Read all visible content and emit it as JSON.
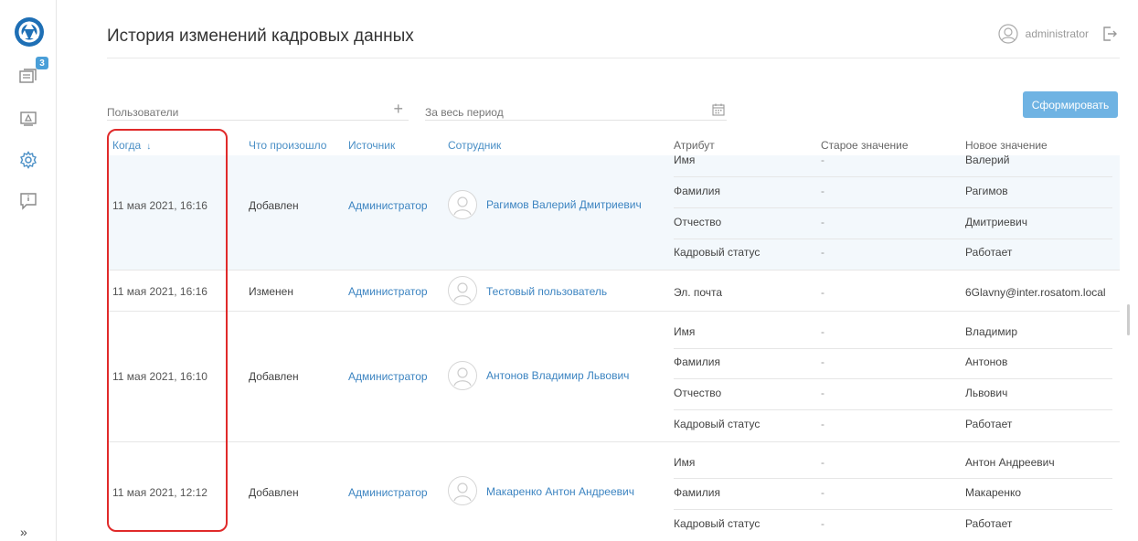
{
  "sidebar": {
    "badge_count": "3",
    "expand_label": "»"
  },
  "header": {
    "title": "История изменений кадровых данных",
    "username": "administrator"
  },
  "filters": {
    "users_placeholder": "Пользователи",
    "period_value": "За весь период",
    "generate_label": "Сформировать"
  },
  "table": {
    "columns": {
      "when": "Когда",
      "what": "Что произошло",
      "source": "Источник",
      "employee": "Сотрудник",
      "attribute": "Атрибут",
      "old_value": "Старое значение",
      "new_value": "Новое значение"
    },
    "rows": [
      {
        "when": "11 мая 2021, 16:16",
        "what": "Добавлен",
        "source": "Администратор",
        "employee": "Рагимов Валерий Дмитриевич",
        "changes": [
          {
            "attribute": "Имя",
            "old": "-",
            "new": "Валерий"
          },
          {
            "attribute": "Фамилия",
            "old": "-",
            "new": "Рагимов"
          },
          {
            "attribute": "Отчество",
            "old": "-",
            "new": "Дмитриевич"
          },
          {
            "attribute": "Кадровый статус",
            "old": "-",
            "new": "Работает"
          }
        ]
      },
      {
        "when": "11 мая 2021, 16:16",
        "what": "Изменен",
        "source": "Администратор",
        "employee": "Тестовый пользователь",
        "changes": [
          {
            "attribute": "Эл. почта",
            "old": "-",
            "new": "6Glavny@inter.rosatom.local"
          }
        ]
      },
      {
        "when": "11 мая 2021, 16:10",
        "what": "Добавлен",
        "source": "Администратор",
        "employee": "Антонов Владимир Львович",
        "changes": [
          {
            "attribute": "Имя",
            "old": "-",
            "new": "Владимир"
          },
          {
            "attribute": "Фамилия",
            "old": "-",
            "new": "Антонов"
          },
          {
            "attribute": "Отчество",
            "old": "-",
            "new": "Львович"
          },
          {
            "attribute": "Кадровый статус",
            "old": "-",
            "new": "Работает"
          }
        ]
      },
      {
        "when": "11 мая 2021, 12:12",
        "what": "Добавлен",
        "source": "Администратор",
        "employee": "Макаренко Антон Андреевич",
        "changes": [
          {
            "attribute": "Имя",
            "old": "-",
            "new": "Антон Андреевич"
          },
          {
            "attribute": "Фамилия",
            "old": "-",
            "new": "Макаренко"
          },
          {
            "attribute": "Кадровый статус",
            "old": "-",
            "new": "Работает"
          }
        ]
      }
    ]
  },
  "colors": {
    "accent": "#4a8fc6",
    "button": "#6fb3e3",
    "highlight": "#e02a2a",
    "selected_row": "#f3f8fc"
  }
}
